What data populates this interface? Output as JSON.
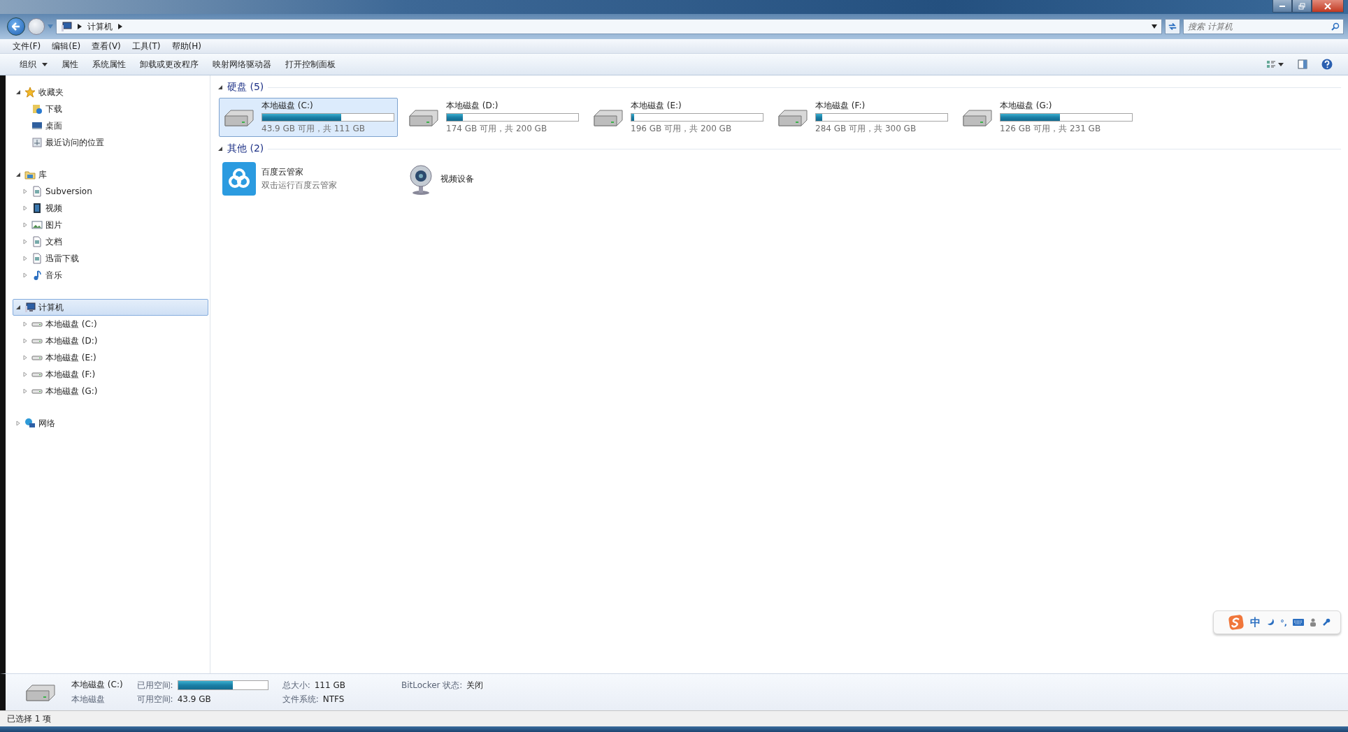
{
  "address": {
    "crumbs": [
      "计算机"
    ]
  },
  "search": {
    "placeholder": "搜索 计算机"
  },
  "menu": [
    "文件(F)",
    "编辑(E)",
    "查看(V)",
    "工具(T)",
    "帮助(H)"
  ],
  "toolbar": [
    {
      "label": "组织",
      "dropdown": true
    },
    {
      "label": "属性",
      "dropdown": false
    },
    {
      "label": "系统属性",
      "dropdown": false
    },
    {
      "label": "卸载或更改程序",
      "dropdown": false
    },
    {
      "label": "映射网络驱动器",
      "dropdown": false
    },
    {
      "label": "打开控制面板",
      "dropdown": false
    }
  ],
  "nav": [
    {
      "label": "收藏夹",
      "kind": "favorites",
      "expandable": true,
      "expanded": true,
      "selected": false,
      "children": [
        {
          "label": "下载",
          "kind": "download",
          "expandable": false,
          "selected": false
        },
        {
          "label": "桌面",
          "kind": "desktop",
          "expandable": false,
          "selected": false
        },
        {
          "label": "最近访问的位置",
          "kind": "recent",
          "expandable": false,
          "selected": false
        }
      ]
    },
    {
      "label": "库",
      "kind": "library",
      "expandable": true,
      "expanded": true,
      "selected": false,
      "children": [
        {
          "label": "Subversion",
          "kind": "doc",
          "expandable": true,
          "expanded": false,
          "selected": false
        },
        {
          "label": "视频",
          "kind": "video",
          "expandable": true,
          "expanded": false,
          "selected": false
        },
        {
          "label": "图片",
          "kind": "picture",
          "expandable": true,
          "expanded": false,
          "selected": false
        },
        {
          "label": "文档",
          "kind": "doc",
          "expandable": true,
          "expanded": false,
          "selected": false
        },
        {
          "label": "迅雷下载",
          "kind": "doc",
          "expandable": true,
          "expanded": false,
          "selected": false
        },
        {
          "label": "音乐",
          "kind": "music",
          "expandable": true,
          "expanded": false,
          "selected": false
        }
      ]
    },
    {
      "label": "计算机",
      "kind": "computer",
      "expandable": true,
      "expanded": true,
      "selected": true,
      "children": [
        {
          "label": "本地磁盘 (C:)",
          "kind": "drive",
          "expandable": true,
          "expanded": false,
          "selected": false
        },
        {
          "label": "本地磁盘 (D:)",
          "kind": "drive",
          "expandable": true,
          "expanded": false,
          "selected": false
        },
        {
          "label": "本地磁盘 (E:)",
          "kind": "drive",
          "expandable": true,
          "expanded": false,
          "selected": false
        },
        {
          "label": "本地磁盘 (F:)",
          "kind": "drive",
          "expandable": true,
          "expanded": false,
          "selected": false
        },
        {
          "label": "本地磁盘 (G:)",
          "kind": "drive",
          "expandable": true,
          "expanded": false,
          "selected": false
        }
      ]
    },
    {
      "label": "网络",
      "kind": "network",
      "expandable": true,
      "expanded": false,
      "selected": false
    }
  ],
  "groups": [
    {
      "title": "硬盘 (5)",
      "expanded": true,
      "items": [
        {
          "kind": "drive",
          "name": "本地磁盘 (C:)",
          "level": 0.6,
          "info": "43.9 GB 可用，共 111 GB",
          "selected": true
        },
        {
          "kind": "drive",
          "name": "本地磁盘 (D:)",
          "level": 0.12,
          "info": "174 GB 可用，共 200 GB",
          "selected": false
        },
        {
          "kind": "drive",
          "name": "本地磁盘 (E:)",
          "level": 0.02,
          "info": "196 GB 可用，共 200 GB",
          "selected": false
        },
        {
          "kind": "drive",
          "name": "本地磁盘 (F:)",
          "level": 0.05,
          "info": "284 GB 可用，共 300 GB",
          "selected": false
        },
        {
          "kind": "drive",
          "name": "本地磁盘 (G:)",
          "level": 0.45,
          "info": "126 GB 可用，共 231 GB",
          "selected": false
        }
      ]
    },
    {
      "title": "其他 (2)",
      "expanded": true,
      "items": [
        {
          "kind": "cloud",
          "name": "百度云管家",
          "info": "双击运行百度云管家",
          "selected": false
        },
        {
          "kind": "webcam",
          "name": "视频设备",
          "selected": false
        }
      ]
    }
  ],
  "ime": {
    "mode": "中",
    "punct": "°,"
  },
  "details": {
    "name": "本地磁盘 (C:)",
    "type": "本地磁盘",
    "used_label": "已用空间:",
    "level": 0.61,
    "free_label": "可用空间:",
    "free": "43.9 GB",
    "total_label": "总大小:",
    "total": "111 GB",
    "fs_label": "文件系统:",
    "fs": "NTFS",
    "bitlocker_label": "BitLocker 状态:",
    "bitlocker": "关闭"
  },
  "status_bar": "已选择 1 项"
}
